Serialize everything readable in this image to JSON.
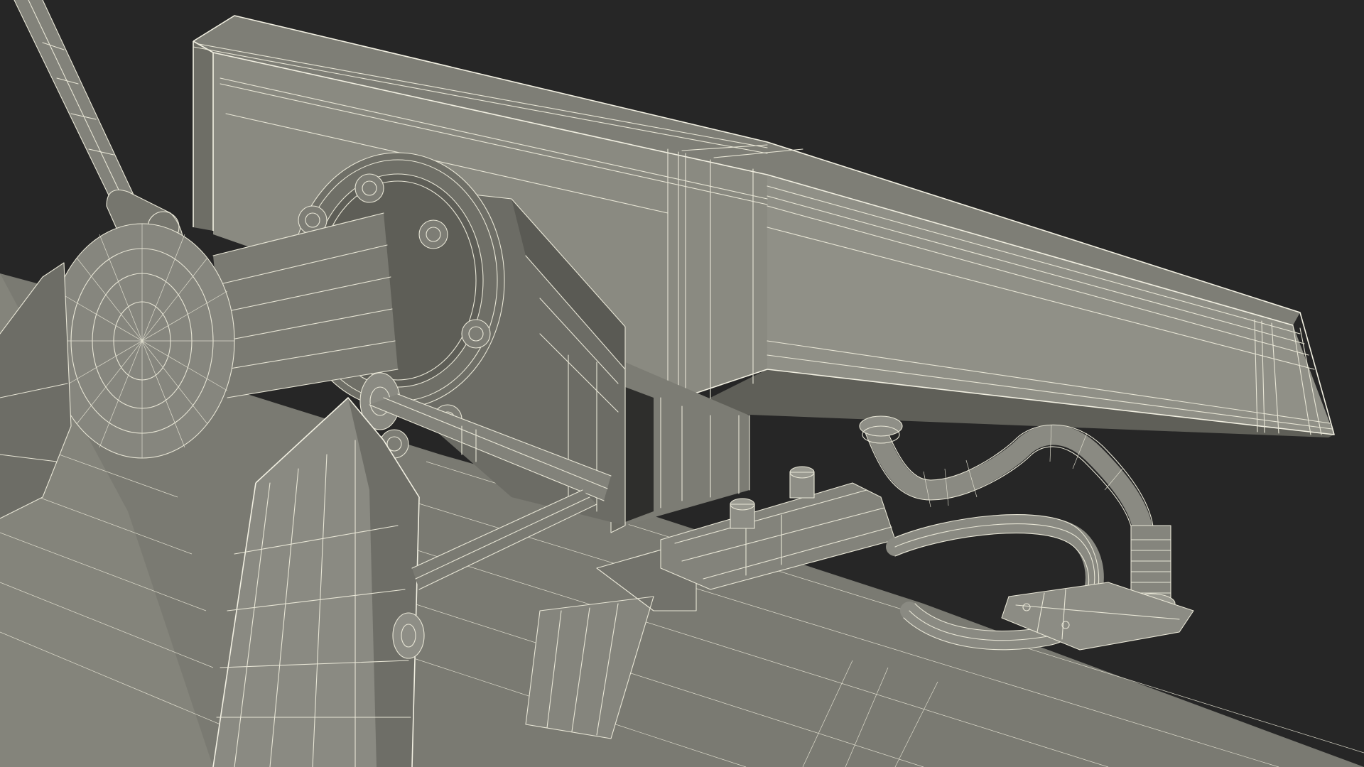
{
  "scene": {
    "background_color": "#262626",
    "surface_color_light": "#8f8f86",
    "surface_color_mid": "#76766d",
    "surface_color_dark": "#5c5c55",
    "wire_color": "#e8e6d6"
  }
}
